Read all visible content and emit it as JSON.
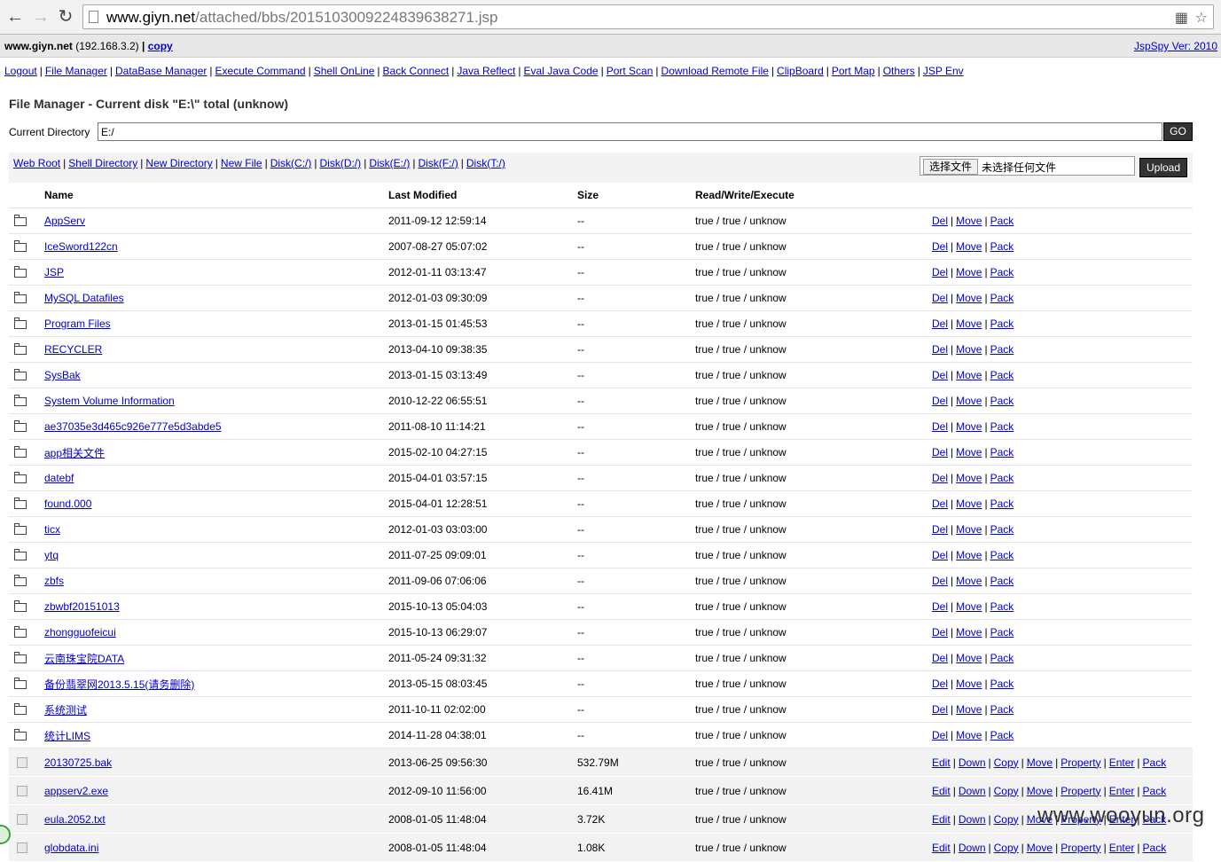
{
  "browser": {
    "url_host": "www.giyn.net",
    "url_path": "/attached/bbs/2015103009224839638271.jsp"
  },
  "header": {
    "host": "www.giyn.net",
    "ip": "(192.168.3.2)",
    "copy_label": "copy",
    "version": "JspSpy Ver: 2010"
  },
  "menu": [
    "Logout",
    "File Manager",
    "DataBase Manager",
    "Execute Command",
    "Shell OnLine",
    "Back Connect",
    "Java Reflect",
    "Eval Java Code",
    "Port Scan",
    "Download Remote File",
    "ClipBoard",
    "Port Map",
    "Others",
    "JSP Env"
  ],
  "file_manager": {
    "title": "File Manager - Current disk \"E:\\\" total (unknow)",
    "dir_label": "Current Directory",
    "dir_value": "E:/",
    "go_label": "GO",
    "quick_links": [
      "Web Root",
      "Shell Directory",
      "New Directory",
      "New File",
      "Disk(C:/)",
      "Disk(D:/)",
      "Disk(E:/)",
      "Disk(F:/)",
      "Disk(T:/)"
    ],
    "choose_label": "选择文件",
    "no_file_label": "未选择任何文件",
    "upload_label": "Upload"
  },
  "table": {
    "headers": {
      "name": "Name",
      "modified": "Last Modified",
      "size": "Size",
      "rwx": "Read/Write/Execute"
    },
    "dir_actions": [
      "Del",
      "Move",
      "Pack"
    ],
    "file_actions": [
      "Edit",
      "Down",
      "Copy",
      "Move",
      "Property",
      "Enter",
      "Pack"
    ],
    "dirs": [
      {
        "name": "AppServ",
        "modified": "2011-09-12 12:59:14",
        "size": "--",
        "rwx": "true / true / unknow"
      },
      {
        "name": "IceSword122cn",
        "modified": "2007-08-27 05:07:02",
        "size": "--",
        "rwx": "true / true / unknow"
      },
      {
        "name": "JSP",
        "modified": "2012-01-11 03:13:47",
        "size": "--",
        "rwx": "true / true / unknow"
      },
      {
        "name": "MySQL Datafiles",
        "modified": "2012-01-03 09:30:09",
        "size": "--",
        "rwx": "true / true / unknow"
      },
      {
        "name": "Program Files",
        "modified": "2013-01-15 01:45:53",
        "size": "--",
        "rwx": "true / true / unknow"
      },
      {
        "name": "RECYCLER",
        "modified": "2013-04-10 09:38:35",
        "size": "--",
        "rwx": "true / true / unknow"
      },
      {
        "name": "SysBak",
        "modified": "2013-01-15 03:13:49",
        "size": "--",
        "rwx": "true / true / unknow"
      },
      {
        "name": "System Volume Information",
        "modified": "2010-12-22 06:55:51",
        "size": "--",
        "rwx": "true / true / unknow"
      },
      {
        "name": "ae37035e3d465c926e777e5d3abde5",
        "modified": "2011-08-10 11:14:21",
        "size": "--",
        "rwx": "true / true / unknow"
      },
      {
        "name": "app相关文件",
        "modified": "2015-02-10 04:27:15",
        "size": "--",
        "rwx": "true / true / unknow"
      },
      {
        "name": "datebf",
        "modified": "2015-04-01 03:57:15",
        "size": "--",
        "rwx": "true / true / unknow"
      },
      {
        "name": "found.000",
        "modified": "2015-04-01 12:28:51",
        "size": "--",
        "rwx": "true / true / unknow"
      },
      {
        "name": "ticx",
        "modified": "2012-01-03 03:03:00",
        "size": "--",
        "rwx": "true / true / unknow"
      },
      {
        "name": "ytq",
        "modified": "2011-07-25 09:09:01",
        "size": "--",
        "rwx": "true / true / unknow"
      },
      {
        "name": "zbfs",
        "modified": "2011-09-06 07:06:06",
        "size": "--",
        "rwx": "true / true / unknow"
      },
      {
        "name": "zbwbf20151013",
        "modified": "2015-10-13 05:04:03",
        "size": "--",
        "rwx": "true / true / unknow"
      },
      {
        "name": "zhongguofeicui",
        "modified": "2015-10-13 06:29:07",
        "size": "--",
        "rwx": "true / true / unknow"
      },
      {
        "name": "云南珠宝院DATA",
        "modified": "2011-05-24 09:31:32",
        "size": "--",
        "rwx": "true / true / unknow"
      },
      {
        "name": "备份翡翠网2013.5.15(请务删除)",
        "modified": "2013-05-15 08:03:45",
        "size": "--",
        "rwx": "true / true / unknow"
      },
      {
        "name": "系统测试",
        "modified": "2011-10-11 02:02:00",
        "size": "--",
        "rwx": "true / true / unknow"
      },
      {
        "name": "统计LIMS",
        "modified": "2014-11-28 04:38:01",
        "size": "--",
        "rwx": "true / true / unknow"
      }
    ],
    "files": [
      {
        "name": "20130725.bak",
        "modified": "2013-06-25 09:56:30",
        "size": "532.79M",
        "rwx": "true / true / unknow"
      },
      {
        "name": "appserv2.exe",
        "modified": "2012-09-10 11:56:00",
        "size": "16.41M",
        "rwx": "true / true / unknow"
      },
      {
        "name": "eula.2052.txt",
        "modified": "2008-01-05 11:48:04",
        "size": "3.72K",
        "rwx": "true / true / unknow"
      },
      {
        "name": "globdata.ini",
        "modified": "2008-01-05 11:48:04",
        "size": "1.08K",
        "rwx": "true / true / unknow"
      }
    ]
  },
  "watermark": "www.wooyun.org"
}
